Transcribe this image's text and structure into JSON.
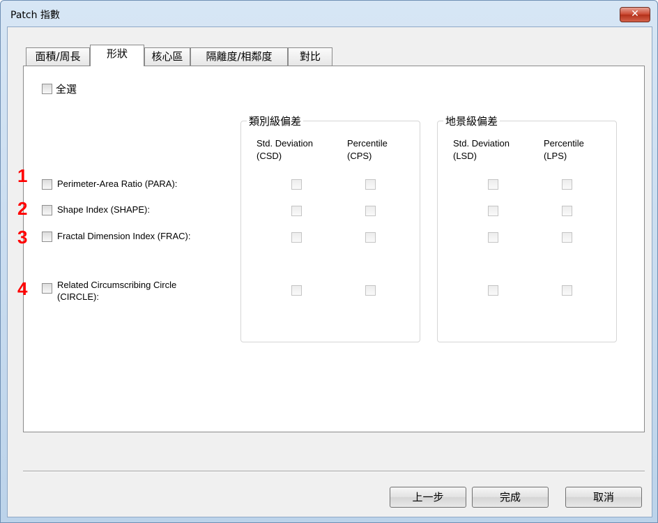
{
  "window": {
    "title": "Patch 指數",
    "close_symbol": "✕"
  },
  "tabs": [
    "面積/周長",
    "形狀",
    "核心區",
    "隔離度/相鄰度",
    "對比"
  ],
  "select_all": "全選",
  "groups": {
    "class": {
      "title": "類別級偏差",
      "col1": [
        "Std. Deviation",
        "(CSD)"
      ],
      "col2": [
        "Percentile",
        "(CPS)"
      ]
    },
    "landscape": {
      "title": "地景級偏差",
      "col1": [
        "Std. Deviation",
        "(LSD)"
      ],
      "col2": [
        "Percentile",
        "(LPS)"
      ]
    }
  },
  "metrics": [
    {
      "marker": "1",
      "label": "Perimeter-Area Ratio (PARA):"
    },
    {
      "marker": "2",
      "label": "Shape Index (SHAPE):"
    },
    {
      "marker": "3",
      "label": "Fractal Dimension Index (FRAC):"
    },
    {
      "marker": "4",
      "label_line1": "Related Circumscribing Circle",
      "label_line2": "(CIRCLE):"
    }
  ],
  "buttons": {
    "back": "上一步",
    "finish": "完成",
    "cancel": "取消"
  }
}
